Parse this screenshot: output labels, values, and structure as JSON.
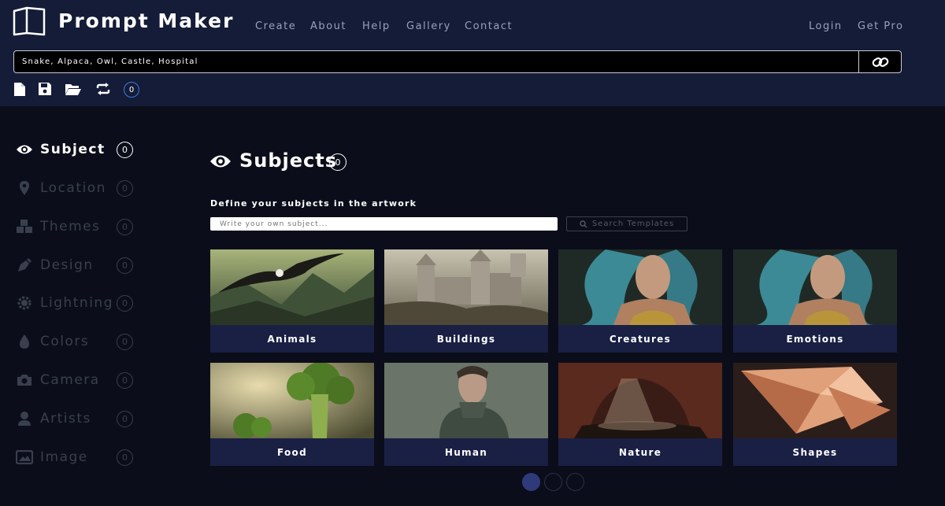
{
  "app": {
    "title": "Prompt Maker"
  },
  "nav": {
    "create": "Create",
    "about": "About",
    "help": "Help",
    "gallery": "Gallery",
    "contact": "Contact",
    "login": "Login",
    "get_pro": "Get Pro"
  },
  "prompt": {
    "value": "Snake, Alpaca, Owl, Castle, Hospital"
  },
  "toolbar": {
    "count": "0"
  },
  "sidebar": {
    "items": [
      {
        "label": "Subject",
        "count": "0",
        "icon": "eye-icon"
      },
      {
        "label": "Location",
        "count": "0",
        "icon": "map-pin-icon"
      },
      {
        "label": "Themes",
        "count": "0",
        "icon": "cubes-icon"
      },
      {
        "label": "Design",
        "count": "0",
        "icon": "pen-nib-icon"
      },
      {
        "label": "Lightning",
        "count": "0",
        "icon": "sun-icon"
      },
      {
        "label": "Colors",
        "count": "0",
        "icon": "droplet-icon"
      },
      {
        "label": "Camera",
        "count": "0",
        "icon": "camera-icon"
      },
      {
        "label": "Artists",
        "count": "0",
        "icon": "user-icon"
      },
      {
        "label": "Image",
        "count": "0",
        "icon": "images-icon"
      }
    ]
  },
  "main": {
    "title": "Subjects",
    "count": "0",
    "subtitle": "Define your subjects in the artwork",
    "input_placeholder": "Write your own subject...",
    "search_label": "Search Templates",
    "cards": [
      {
        "label": "Animals"
      },
      {
        "label": "Buildings"
      },
      {
        "label": "Creatures"
      },
      {
        "label": "Emotions"
      },
      {
        "label": "Food"
      },
      {
        "label": "Human"
      },
      {
        "label": "Nature"
      },
      {
        "label": "Shapes"
      }
    ],
    "pagination": {
      "pages": 3,
      "current": 1
    }
  },
  "colors": {
    "header_bg": "#151c38",
    "page_bg": "#0b0e1a",
    "card_label_bg": "#1a2044",
    "accent": "#3d7be0"
  }
}
